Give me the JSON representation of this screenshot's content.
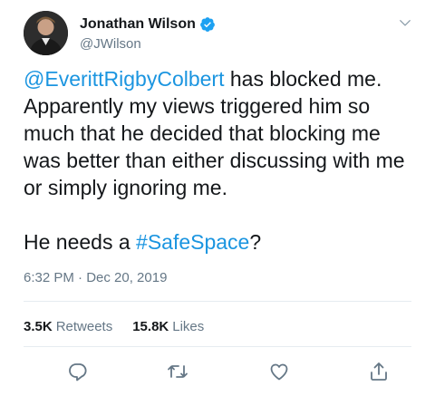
{
  "tweet": {
    "author_name": "Jonathan Wilson",
    "author_handle": "@JWilson",
    "mention": "@EverittRigbyColbert",
    "text_after_mention": " has blocked me. Apparently my views triggered him so much that he decided that blocking me was better than either discussing with me or simply ignoring me.",
    "line2_prefix": "He needs a ",
    "hashtag": "#SafeSpace",
    "line2_suffix": "?",
    "timestamp": "6:32 PM · Dec 20, 2019",
    "retweets_count": "3.5K",
    "retweets_label": "Retweets",
    "likes_count": "15.8K",
    "likes_label": "Likes"
  },
  "icons": {
    "verified": "verified-badge-icon",
    "menu": "chevron-down-icon",
    "reply": "reply-icon",
    "retweet": "retweet-icon",
    "like": "heart-icon",
    "share": "share-icon"
  },
  "colors": {
    "link": "#1b95e0",
    "text": "#14171a",
    "secondary": "#657786",
    "divider": "#e6ecf0"
  }
}
